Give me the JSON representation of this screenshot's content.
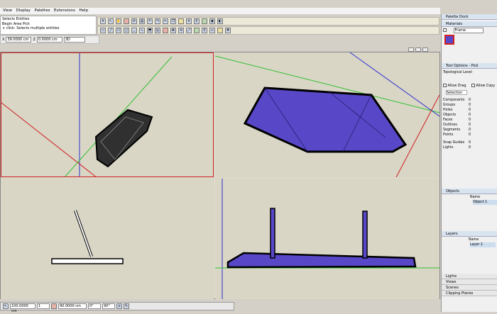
{
  "menu": [
    "View",
    "Display",
    "Palettes",
    "Extensions",
    "Help"
  ],
  "hints": [
    "Selects Entities",
    "Begin Area Pick",
    "+ click: Selects multiple entities"
  ],
  "measure": {
    "label_a": "X",
    "value_a": "39.0000 cm",
    "label_b": "Z",
    "value_b": "0.0000 cm",
    "mode": "3D"
  },
  "status": {
    "value": "100.0000 cm",
    "num": "1",
    "readout": "90.0000 cm",
    "angle": "90°",
    "zoom": "0°"
  },
  "dock": {
    "title": "Palette Dock",
    "materials": {
      "title": "Materials",
      "selected": "Frame"
    },
    "tool": {
      "title": "Tool Options - Pick",
      "level": "Topological Level",
      "allow_drag": "Allow Drag",
      "allow_copy": "Allow Copy",
      "selection_tab": "Selection",
      "rows": [
        {
          "label": "Components",
          "value": "0"
        },
        {
          "label": "Groups",
          "value": "0"
        },
        {
          "label": "Holes",
          "value": "0"
        },
        {
          "label": "Objects",
          "value": "0"
        },
        {
          "label": "Faces",
          "value": "0"
        },
        {
          "label": "Outlines",
          "value": "0"
        },
        {
          "label": "Segments",
          "value": "0"
        },
        {
          "label": "Points",
          "value": "0"
        },
        {
          "label": "Snap Guides",
          "value": "0"
        },
        {
          "label": "Lights",
          "value": "0"
        }
      ]
    },
    "objects": {
      "title": "Objects",
      "header": "Name",
      "item": "Object 1"
    },
    "layers": {
      "title": "Layers",
      "header": "Name",
      "item": "Layer 1"
    },
    "collapsed": [
      "Lights",
      "Views",
      "Scenes",
      "Clipping Planes"
    ]
  },
  "colors": {
    "shape_fill": "#5848c8",
    "grid_red": "#d02020",
    "grid_green": "#30c030",
    "grid_blue": "#3030d0",
    "viewport_bg": "#d9d6c6"
  }
}
